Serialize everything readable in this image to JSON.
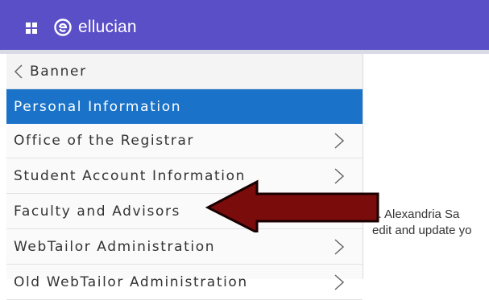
{
  "header": {
    "app_switcher_icon": "grid-icon",
    "logo_icon": "ellucian-logo-icon",
    "logo_text": "ellucian",
    "bar_color": "#5b4fc8"
  },
  "menu": {
    "back_label": "Banner",
    "back_icon": "chevron-left-icon",
    "items": [
      {
        "label": "Personal Information",
        "active": true
      },
      {
        "label": "Office of the Registrar",
        "icon": "chevron-right-icon"
      },
      {
        "label": "Student Account Information",
        "icon": "chevron-right-icon"
      },
      {
        "label": "Faculty and Advisors",
        "icon": "chevron-right-icon"
      },
      {
        "label": "WebTailor Administration",
        "icon": "chevron-right-icon"
      },
      {
        "label": "Old WebTailor Administration",
        "icon": "chevron-right-icon"
      }
    ],
    "active_color": "#1a73c8"
  },
  "content": {
    "line1": "s. Alexandria Sa",
    "line2": "edit and update yo"
  },
  "annotation": {
    "arrow_icon": "red-arrow-icon",
    "arrow_color": "#7a0c0c"
  }
}
